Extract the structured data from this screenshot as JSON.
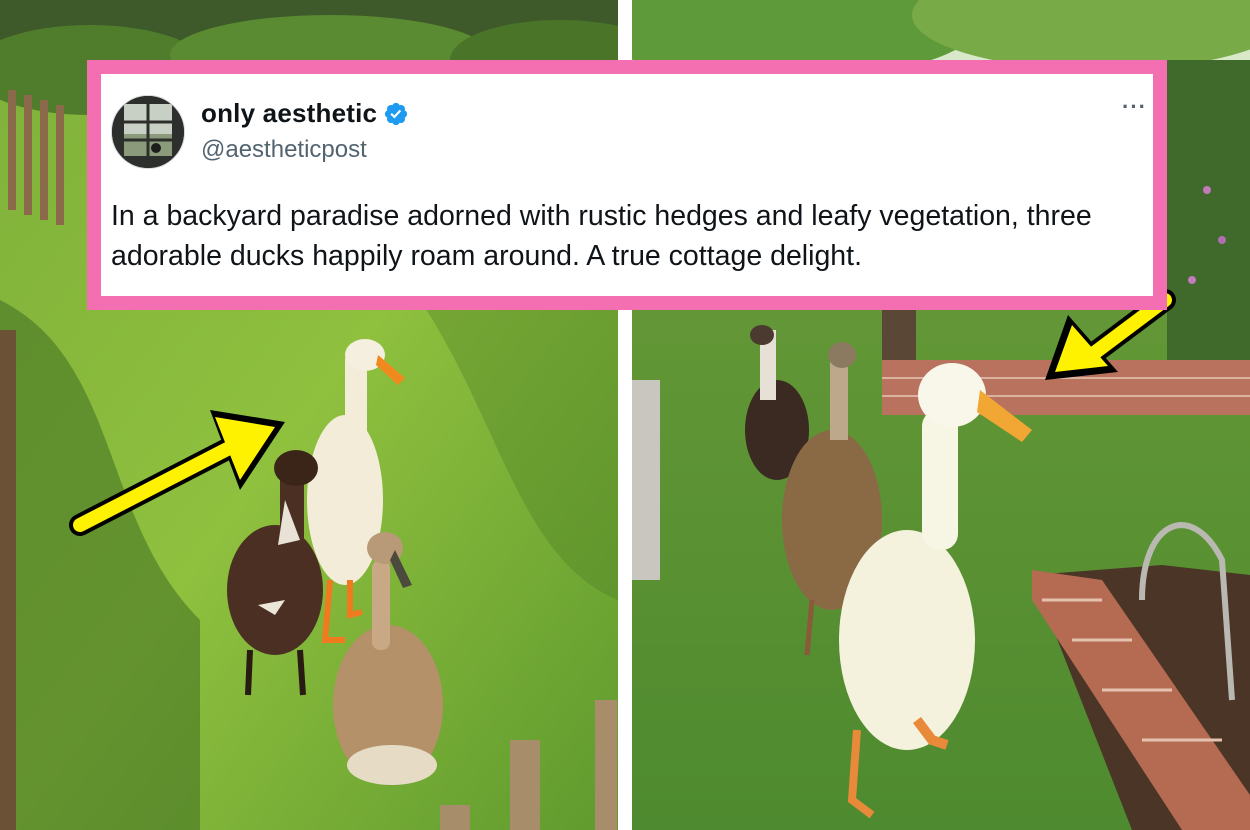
{
  "tweet": {
    "display_name": "only aesthetic",
    "handle": "@aestheticpost",
    "text": "In a backyard paradise adorned with rustic hedges and leafy vegetation, three adorable ducks happily roam around. A true cottage delight.",
    "more_menu": "···",
    "verified_icon": "verified-badge-icon",
    "avatar_icon": "window-scene-avatar"
  },
  "colors": {
    "frame_border": "#f46fb2",
    "verified_blue": "#1d9bf0",
    "arrow_yellow": "#fff200"
  }
}
